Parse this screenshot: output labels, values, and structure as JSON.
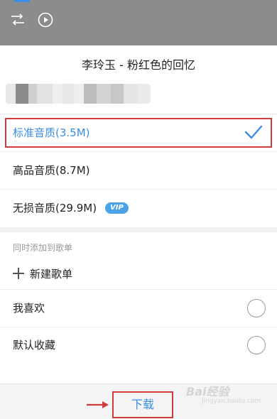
{
  "dialog": {
    "song_title": "李玲玉 - 粉红色的回忆"
  },
  "quality_options": [
    {
      "label": "标准音质(3.5M)",
      "selected": true
    },
    {
      "label": "高品音质(8.7M)",
      "selected": false
    },
    {
      "label": "无损音质(29.9M)",
      "selected": false,
      "badge": "VIP"
    }
  ],
  "playlists": {
    "section_label": "同时添加到歌单",
    "new_playlist_label": "新建歌单",
    "items": [
      {
        "label": "我喜欢"
      },
      {
        "label": "默认收藏"
      }
    ]
  },
  "footer": {
    "download_label": "下载"
  },
  "watermark": {
    "brand": "Bai经验",
    "url": "jingyan.baidu.com"
  },
  "colors": {
    "accent": "#3a8ee6",
    "annotation_red": "#d23b3b",
    "vip_badge": "#4aa3e8"
  },
  "icons": {
    "top_left_1": "shuffle-icon",
    "top_left_2": "play-circle-icon",
    "selected": "check-icon",
    "new": "plus-icon"
  }
}
